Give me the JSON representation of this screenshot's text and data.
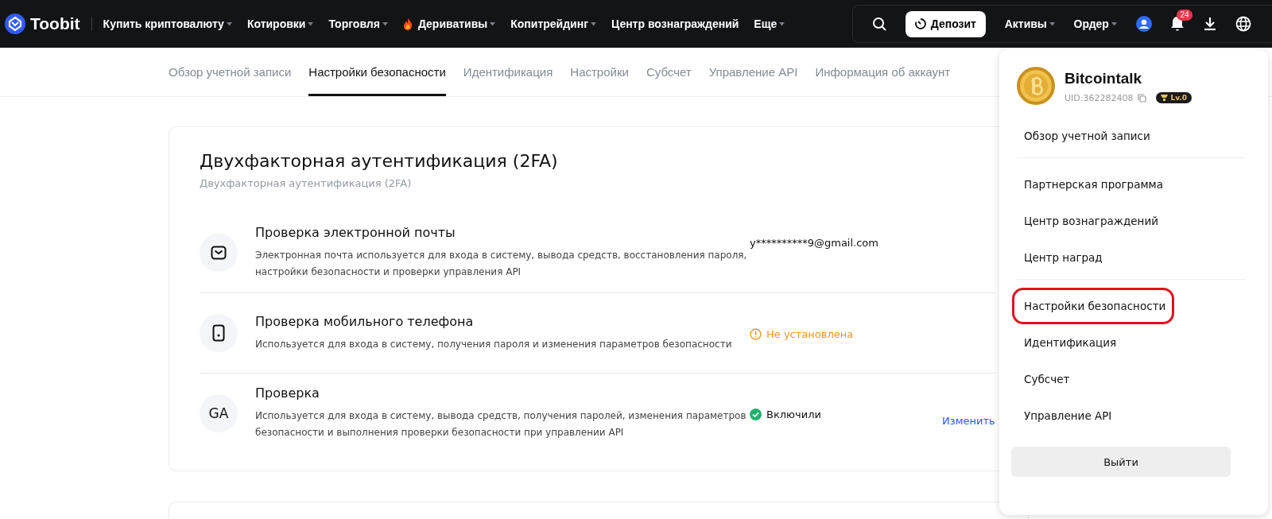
{
  "brand": "Toobit",
  "nav": [
    {
      "label": "Купить криптовалюту",
      "dropdown": true,
      "hot": false
    },
    {
      "label": "Котировки",
      "dropdown": true,
      "hot": false
    },
    {
      "label": "Торговля",
      "dropdown": true,
      "hot": false
    },
    {
      "label": "Деривативы",
      "dropdown": true,
      "hot": true
    },
    {
      "label": "Копитрейдинг",
      "dropdown": true,
      "hot": false
    },
    {
      "label": "Центр вознаграждений",
      "dropdown": false,
      "hot": false
    },
    {
      "label": "Еще",
      "dropdown": true,
      "hot": false
    }
  ],
  "deposit_button": "Депозит",
  "right_nav": [
    {
      "label": "Активы"
    },
    {
      "label": "Ордер"
    }
  ],
  "notifications": "24",
  "tabs": [
    {
      "label": "Обзор учетной записи",
      "selected": false
    },
    {
      "label": "Настройки безопасности",
      "selected": true
    },
    {
      "label": "Идентификация",
      "selected": false
    },
    {
      "label": "Настройки",
      "selected": false
    },
    {
      "label": "Субсчет",
      "selected": false
    },
    {
      "label": "Управление API",
      "selected": false
    },
    {
      "label": "Информация об аккаунт",
      "selected": false
    }
  ],
  "card": {
    "title": "Двухфакторная аутентификация (2FA)",
    "subtitle": "Двухфакторная аутентификация (2FA)",
    "rows": [
      {
        "kind": "email",
        "title": "Проверка электронной почты",
        "description": "Электронная почта используется для входа в систему, вывода средств, восстановления пароля, настройки безопасности и проверки управления API",
        "status": {
          "kind": "value",
          "text": "y**********9@gmail.com"
        }
      },
      {
        "kind": "phone",
        "title": "Проверка мобильного телефона",
        "description": "Используется для входа в систему, получения пароля и изменения параметров безопасности",
        "status": {
          "kind": "warning",
          "text": "Не установлена"
        }
      },
      {
        "kind": "ga",
        "icon_text": "GA",
        "title": "Проверка",
        "description": "Используется для входа в систему, вывода средств, получения паролей, изменения параметров безопасности и выполнения проверки безопасности при управлении API",
        "status": {
          "kind": "ok",
          "text": "Включили"
        },
        "action": "Изменить"
      }
    ]
  },
  "profile_menu": {
    "name": "Bitcointalk",
    "uid": "UID:362282408",
    "level": "Lv.0",
    "groups": [
      [
        {
          "label": "Обзор учетной записи",
          "highlighted": false
        }
      ],
      [
        {
          "label": "Партнерская программа",
          "highlighted": false
        },
        {
          "label": "Центр вознаграждений",
          "highlighted": false
        },
        {
          "label": "Центр наград",
          "highlighted": false
        }
      ],
      [
        {
          "label": "Настройки безопасности",
          "highlighted": true
        },
        {
          "label": "Идентификация",
          "highlighted": false
        },
        {
          "label": "Субсчет",
          "highlighted": false
        },
        {
          "label": "Управление API",
          "highlighted": false
        }
      ]
    ],
    "logout": "Выйти"
  }
}
